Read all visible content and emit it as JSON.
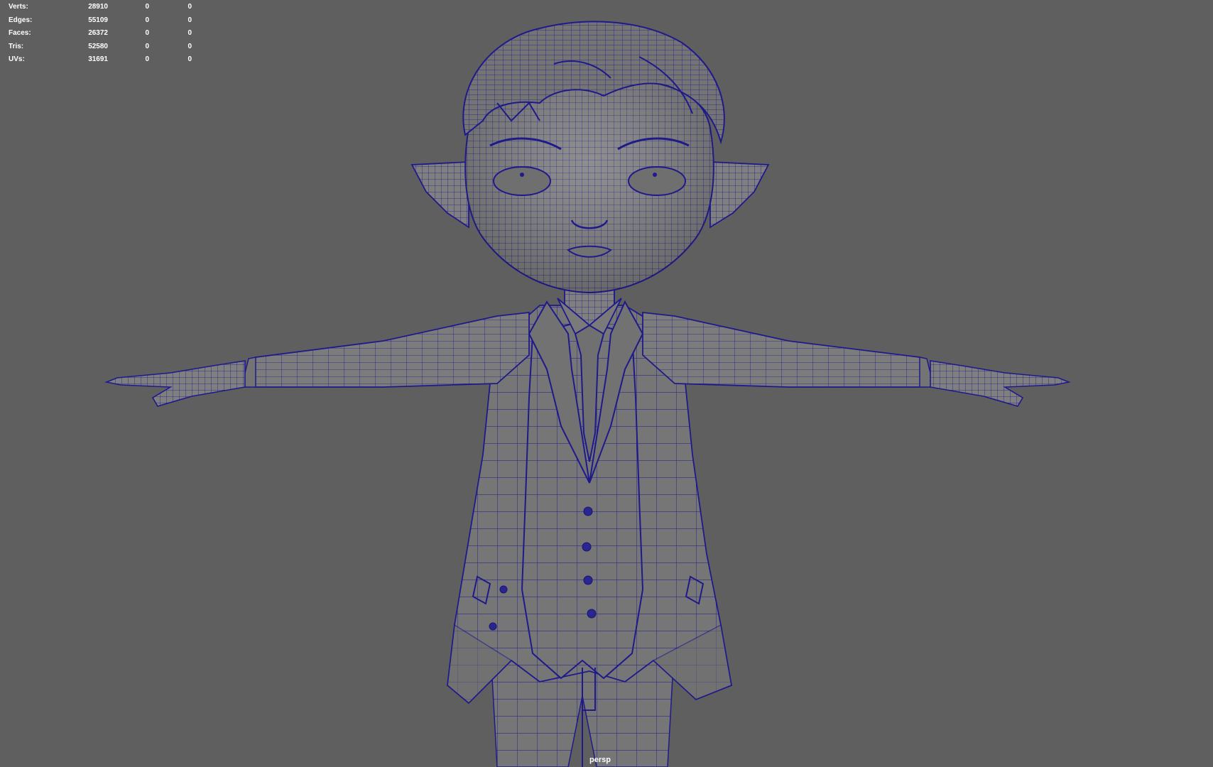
{
  "hud": {
    "rows": [
      {
        "label": "Verts:",
        "total": "28910",
        "selected": "0",
        "component": "0"
      },
      {
        "label": "Edges:",
        "total": "55109",
        "selected": "0",
        "component": "0"
      },
      {
        "label": "Faces:",
        "total": "26372",
        "selected": "0",
        "component": "0"
      },
      {
        "label": "Tris:",
        "total": "52580",
        "selected": "0",
        "component": "0"
      },
      {
        "label": "UVs:",
        "total": "31691",
        "selected": "0",
        "component": "0"
      }
    ]
  },
  "viewport": {
    "camera": "persp",
    "background_color": "#5f5f5f",
    "wireframe_color": "#1e1a8c",
    "surface_color": "#7a7a7a"
  }
}
